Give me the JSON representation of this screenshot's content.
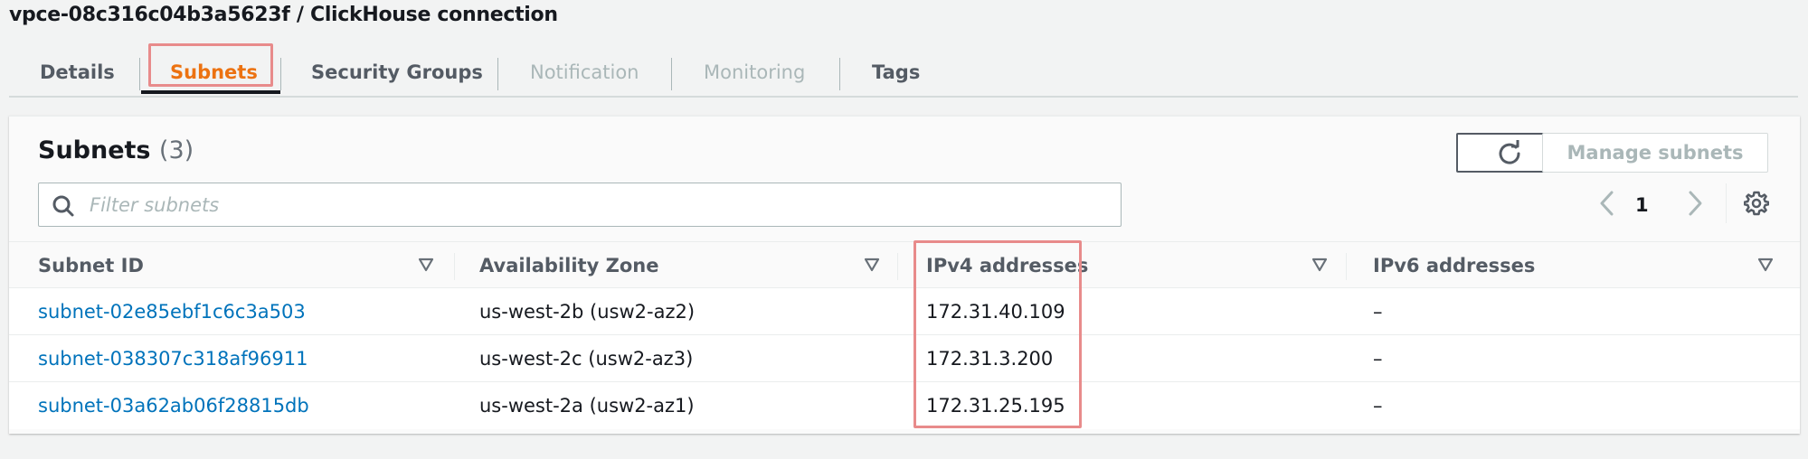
{
  "page": {
    "title": "vpce-08c316c04b3a5623f / ClickHouse connection"
  },
  "tabs": [
    {
      "label": "Details",
      "state": "normal"
    },
    {
      "label": "Subnets",
      "state": "active"
    },
    {
      "label": "Security Groups",
      "state": "normal"
    },
    {
      "label": "Notification",
      "state": "disabled"
    },
    {
      "label": "Monitoring",
      "state": "disabled"
    },
    {
      "label": "Tags",
      "state": "normal"
    }
  ],
  "panel": {
    "title": "Subnets",
    "count": "(3)",
    "refresh_icon": "refresh-icon",
    "manage_label": "Manage subnets",
    "filter": {
      "placeholder": "Filter subnets",
      "value": ""
    },
    "pagination": {
      "current_page": "1",
      "prev_icon": "chevron-left-icon",
      "next_icon": "chevron-right-icon"
    },
    "settings_icon": "gear-icon"
  },
  "table": {
    "columns": [
      "Subnet ID",
      "Availability Zone",
      "IPv4 addresses",
      "IPv6 addresses"
    ],
    "rows": [
      {
        "subnet_id": "subnet-02e85ebf1c6c3a503",
        "az": "us-west-2b (usw2-az2)",
        "ipv4": "172.31.40.109",
        "ipv6": "–"
      },
      {
        "subnet_id": "subnet-038307c318af96911",
        "az": "us-west-2c (usw2-az3)",
        "ipv4": "172.31.3.200",
        "ipv6": "–"
      },
      {
        "subnet_id": "subnet-03a62ab06f28815db",
        "az": "us-west-2a (usw2-az1)",
        "ipv4": "172.31.25.195",
        "ipv6": "–"
      }
    ]
  },
  "colors": {
    "active_tab": "#ec7211",
    "link": "#0073bb",
    "highlight": "#e88b8b",
    "disabled": "#aab7b8"
  }
}
